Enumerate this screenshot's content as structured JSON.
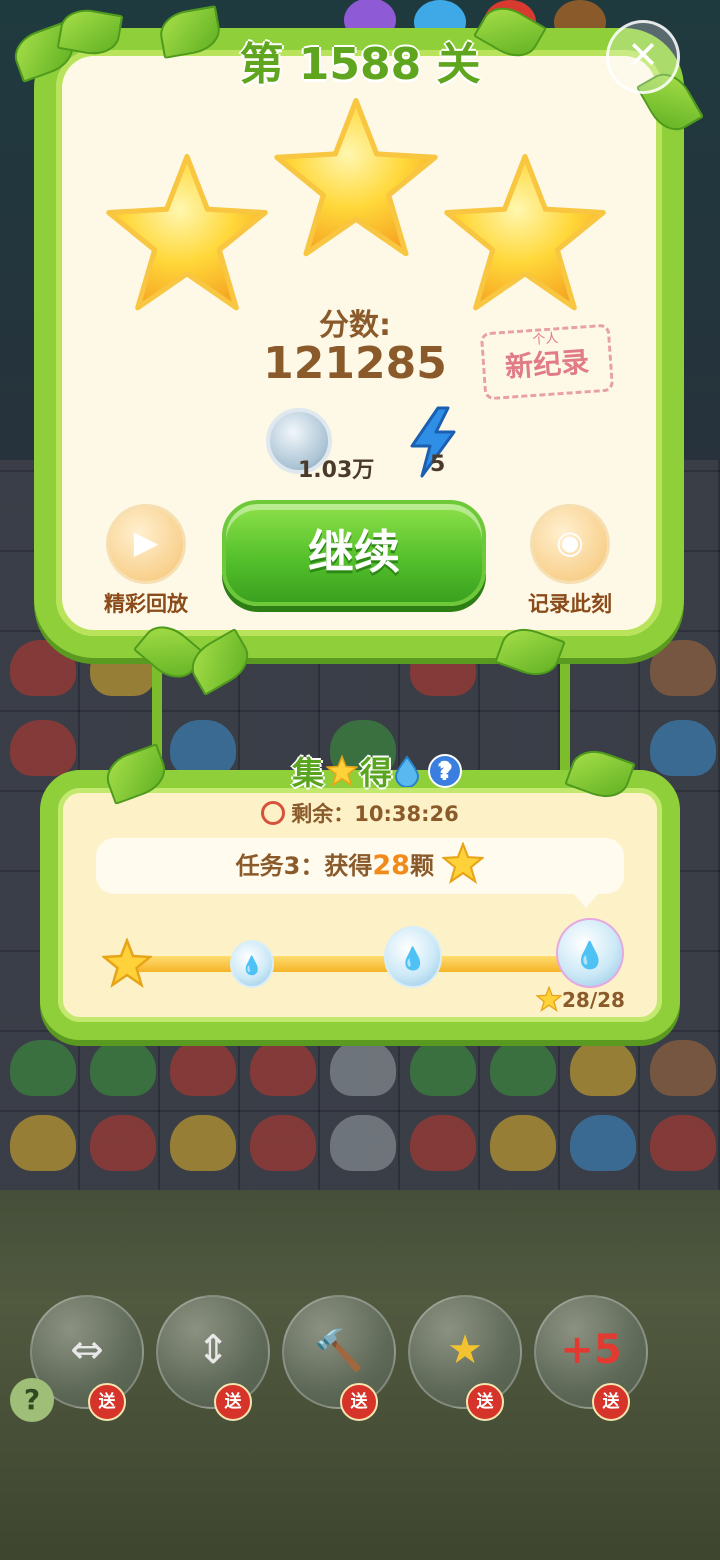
{
  "level": {
    "title": "第 1588 关"
  },
  "close": {
    "label": "✕"
  },
  "result": {
    "stars_earned": 3,
    "score_label": "分数:",
    "score_value": "121285",
    "record_top": "个人",
    "record_main": "新纪录"
  },
  "rewards": {
    "coins": "1.03万",
    "energy": "5"
  },
  "actions": {
    "continue_label": "继续",
    "replay_label": "精彩回放",
    "snapshot_label": "记录此刻"
  },
  "event": {
    "title_part1": "集",
    "title_part2": "得",
    "help": "?",
    "timer_label": "剩余：",
    "timer_value": "10:38:26",
    "task_prefix": "任务3：获得",
    "task_number": "28",
    "task_suffix": "颗",
    "progress_current": 28,
    "progress_total": 28,
    "progress_text": "28/28"
  },
  "boosters": [
    {
      "icon": "swap-icon",
      "glyph": "⇔",
      "gift_label": "送"
    },
    {
      "icon": "rocket-icon",
      "glyph": "⇕",
      "gift_label": "送"
    },
    {
      "icon": "hammer-icon",
      "glyph": "🔨",
      "gift_label": "送"
    },
    {
      "icon": "magic-wand-icon",
      "glyph": "★",
      "gift_label": "送"
    },
    {
      "icon": "plus-five-icon",
      "glyph": "+5",
      "gift_label": "送"
    }
  ],
  "colors": {
    "frame_green": "#8fd03a",
    "panel_cream": "#fdf9e6",
    "text_brown": "#8a5a2b",
    "button_green": "#55c12c",
    "accent_orange": "#f08a1a"
  }
}
